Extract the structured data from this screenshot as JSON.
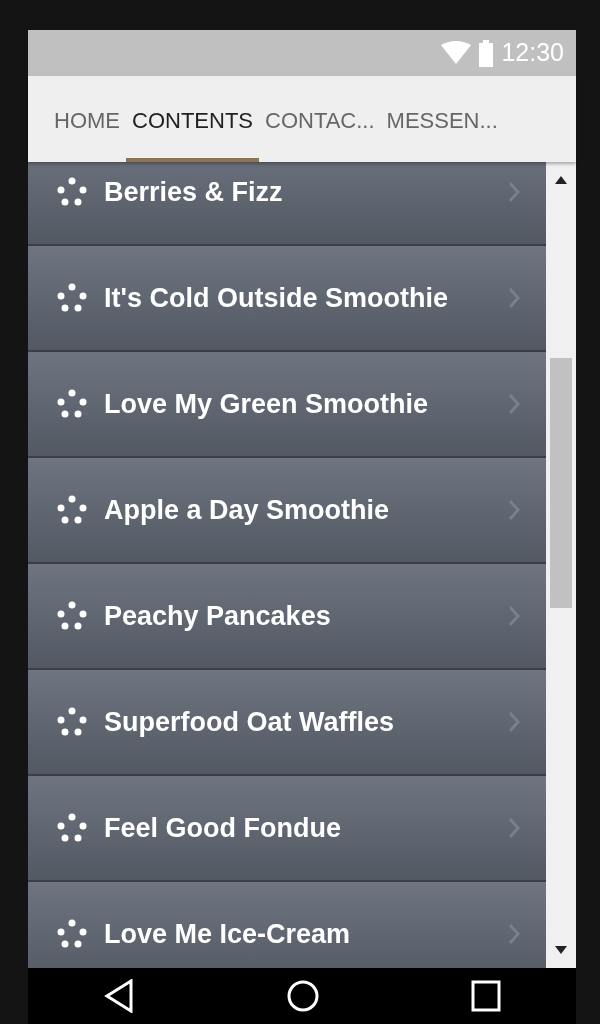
{
  "status_bar": {
    "time": "12:30"
  },
  "tabs": [
    {
      "label": "HOME",
      "selected": false
    },
    {
      "label": "CONTENTS",
      "selected": true
    },
    {
      "label": "CONTAC...",
      "selected": false
    },
    {
      "label": "MESSEN...",
      "selected": false
    }
  ],
  "list": [
    {
      "title": "Berries & Fizz"
    },
    {
      "title": "It's Cold Outside Smoothie"
    },
    {
      "title": "Love My Green Smoothie"
    },
    {
      "title": "Apple a Day Smoothie"
    },
    {
      "title": "Peachy Pancakes"
    },
    {
      "title": "Superfood Oat Waffles"
    },
    {
      "title": "Feel Good Fondue"
    },
    {
      "title": "Love Me Ice-Cream"
    }
  ]
}
